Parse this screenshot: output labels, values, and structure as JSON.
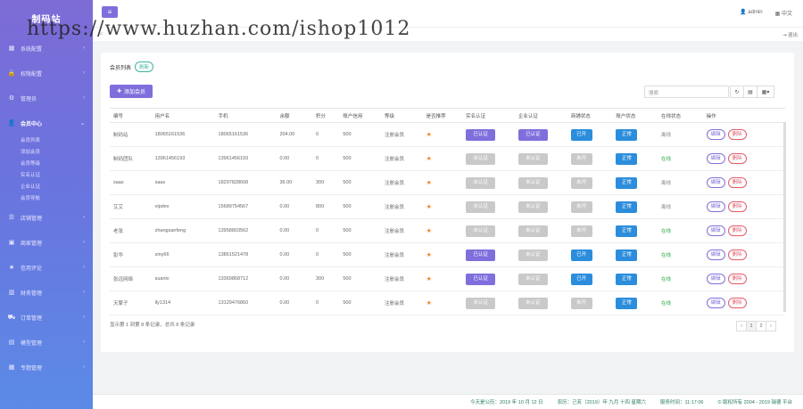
{
  "sidebar": {
    "logo": "制码站",
    "items": [
      {
        "icon": "grid-icon",
        "label": "系统配置"
      },
      {
        "icon": "lock-icon",
        "label": "权限配置"
      },
      {
        "icon": "gear-icon",
        "label": "管理员"
      },
      {
        "icon": "user-icon",
        "label": "会员中心",
        "active": true
      },
      {
        "icon": "list-icon",
        "label": "店铺管理"
      },
      {
        "icon": "box-icon",
        "label": "商家管理"
      },
      {
        "icon": "star-icon",
        "label": "信用评论"
      },
      {
        "icon": "chart-icon",
        "label": "财务管理"
      },
      {
        "icon": "cart-icon",
        "label": "订单管理"
      },
      {
        "icon": "doc-icon",
        "label": "模型管理"
      },
      {
        "icon": "grid-icon",
        "label": "专题管理"
      }
    ],
    "sub_items": [
      "会员列表",
      "添加会员",
      "会员等级",
      "实名认证",
      "企业认证",
      "会员导航"
    ]
  },
  "topbar": {
    "admin": "admin",
    "lang": "中文",
    "exit": "退出"
  },
  "watermark": "https://www.huzhan.com/ishop1012",
  "card": {
    "title": "会员列表",
    "refresh": "刷新",
    "add_button": "添加会员",
    "search_placeholder": "搜索"
  },
  "table": {
    "headers": [
      "编号",
      "用户名",
      "手机",
      "余额",
      "积分",
      "账户信用",
      "等级",
      "是否推荐",
      "实名认证",
      "企业认证",
      "商铺状态",
      "账户状态",
      "在线状态",
      "操作"
    ],
    "rows": [
      {
        "id": "制码站",
        "username": "18065161536",
        "phone": "18065161536",
        "balance": "204.00",
        "points": "0",
        "credit": "500",
        "level": "注册会员",
        "realname": "已认证",
        "realname_ok": true,
        "company": "已认证",
        "company_ok": true,
        "shop": "已开",
        "shop_ok": true,
        "account": "正常",
        "online": "离线",
        "online_ok": false,
        "edit": "编辑",
        "del": "删除"
      },
      {
        "id": "制码团队",
        "username": "13961456193",
        "phone": "13961456193",
        "balance": "0.00",
        "points": "0",
        "credit": "500",
        "level": "注册会员",
        "realname": "未认证",
        "realname_ok": false,
        "company": "未认证",
        "company_ok": false,
        "shop": "未开",
        "shop_ok": false,
        "account": "正常",
        "online": "在线",
        "online_ok": true,
        "edit": "编辑",
        "del": "删除"
      },
      {
        "id": "saas",
        "username": "saas",
        "phone": "18297828608",
        "balance": "36.00",
        "points": "300",
        "credit": "500",
        "level": "注册会员",
        "realname": "未认证",
        "realname_ok": false,
        "company": "未认证",
        "company_ok": false,
        "shop": "未开",
        "shop_ok": false,
        "account": "正常",
        "online": "离线",
        "online_ok": false,
        "edit": "编辑",
        "del": "删除"
      },
      {
        "id": "艾艾",
        "username": "vipdex",
        "phone": "15689754567",
        "balance": "0.00",
        "points": "800",
        "credit": "500",
        "level": "注册会员",
        "realname": "未认证",
        "realname_ok": false,
        "company": "未认证",
        "company_ok": false,
        "shop": "未开",
        "shop_ok": false,
        "account": "正常",
        "online": "离线",
        "online_ok": false,
        "edit": "编辑",
        "del": "删除"
      },
      {
        "id": "老张",
        "username": "zhangsanfeng",
        "phone": "13958803562",
        "balance": "0.00",
        "points": "0",
        "credit": "500",
        "level": "注册会员",
        "realname": "未认证",
        "realname_ok": false,
        "company": "未认证",
        "company_ok": false,
        "shop": "未开",
        "shop_ok": false,
        "account": "正常",
        "online": "在线",
        "online_ok": true,
        "edit": "编辑",
        "del": "删除"
      },
      {
        "id": "彭华",
        "username": "siny66",
        "phone": "13861521478",
        "balance": "0.00",
        "points": "0",
        "credit": "500",
        "level": "注册会员",
        "realname": "已认证",
        "realname_ok": true,
        "company": "未认证",
        "company_ok": false,
        "shop": "已开",
        "shop_ok": true,
        "account": "正常",
        "online": "在线",
        "online_ok": true,
        "edit": "编辑",
        "del": "删除"
      },
      {
        "id": "张远网络",
        "username": "suanlv",
        "phone": "13369868712",
        "balance": "0.00",
        "points": "300",
        "credit": "500",
        "level": "注册会员",
        "realname": "已认证",
        "realname_ok": true,
        "company": "未认证",
        "company_ok": false,
        "shop": "已开",
        "shop_ok": true,
        "account": "正常",
        "online": "在线",
        "online_ok": true,
        "edit": "编辑",
        "del": "删除"
      },
      {
        "id": "天擎子",
        "username": "lly1314",
        "phone": "13129476860",
        "balance": "0.00",
        "points": "0",
        "credit": "500",
        "level": "注册会员",
        "realname": "未认证",
        "realname_ok": false,
        "company": "未认证",
        "company_ok": false,
        "shop": "未开",
        "shop_ok": false,
        "account": "正常",
        "online": "在线",
        "online_ok": true,
        "edit": "编辑",
        "del": "删除"
      }
    ]
  },
  "pagination": {
    "info": "显示第 1 到第 8 条记录，总共 8 条记录",
    "prev": "‹",
    "pages": [
      "1",
      "2"
    ],
    "next": "›"
  },
  "status_bar": {
    "date": "今天是公历：2019 年 10 月 12 日",
    "lunar": "农历：己亥（2019）年 九月 十四  星期六",
    "time": "服务时间：11:17:06",
    "copyright": "© 版权所有 2004 - 2019  瑞德 平台"
  },
  "colors": {
    "accent": "#7e6fdc",
    "blue": "#2b8ddc",
    "online": "#2aa84a",
    "danger": "#e55a6a",
    "star": "#f08a24"
  }
}
